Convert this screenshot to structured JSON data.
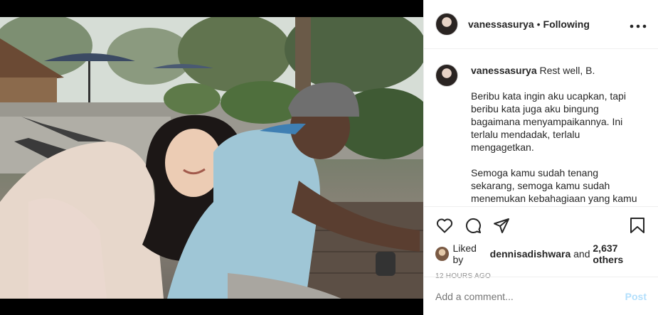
{
  "post": {
    "username": "vanessasurya",
    "separator": "•",
    "follow_status": "Following",
    "more_icon": "more-horizontal-icon"
  },
  "caption": {
    "username": "vanessasurya",
    "first_line": "Rest well, B.",
    "paragraphs": [
      "Beribu kata ingin aku ucapkan, tapi beribu kata juga aku bingung bagaimana menyampaikannya. Ini terlalu mendadak, terlalu mengagetkan.",
      "Semoga kamu sudah tenang sekarang, semoga kamu sudah menemukan kebahagiaan yang kamu cari dan tidak"
    ]
  },
  "actions": {
    "like_icon": "heart-icon",
    "comment_icon": "comment-icon",
    "share_icon": "paper-plane-icon",
    "save_icon": "bookmark-icon"
  },
  "likes": {
    "prefix": "Liked by",
    "liker": "dennisadishwara",
    "conjunction": "and",
    "others": "2,637 others"
  },
  "timestamp": "12 HOURS AGO",
  "comment": {
    "placeholder": "Add a comment...",
    "post_label": "Post"
  },
  "colors": {
    "text": "#262626",
    "muted": "#8e8e8e",
    "post_disabled": "#b2dffc",
    "border": "#efefef"
  }
}
